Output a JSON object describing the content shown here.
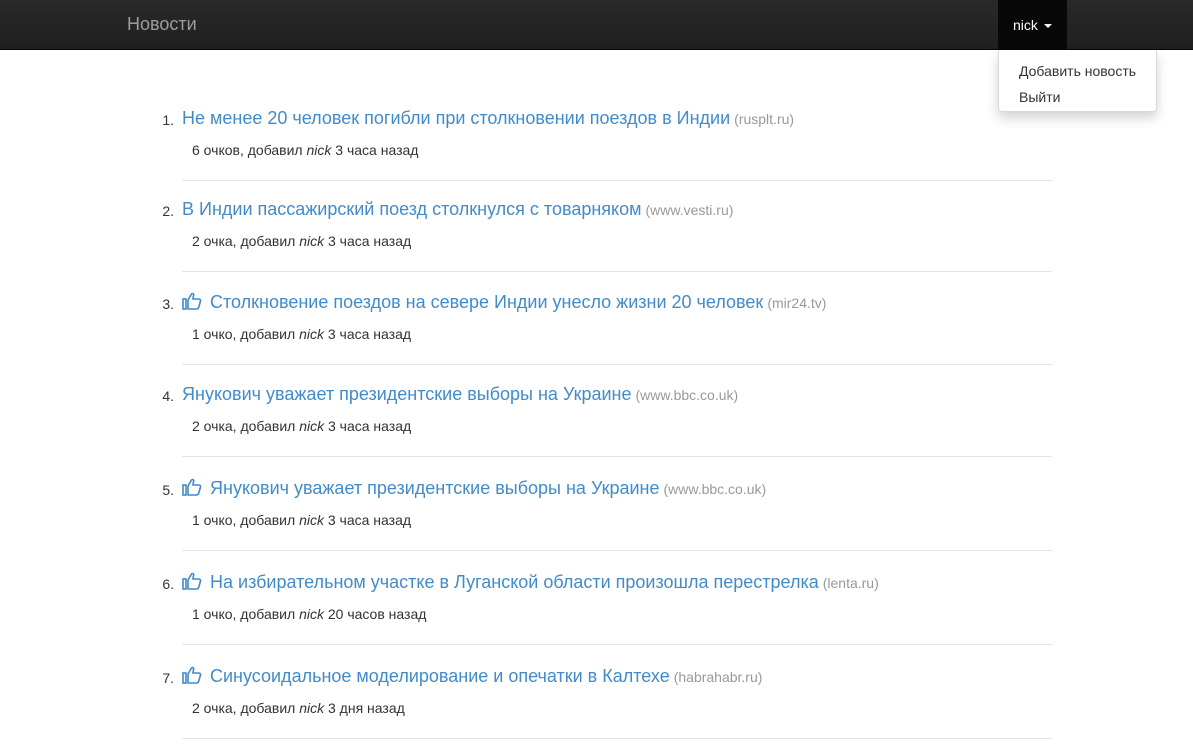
{
  "navbar": {
    "brand": "Новости",
    "user": "nick"
  },
  "dropdown": {
    "items": [
      "Добавить новость",
      "Выйти"
    ]
  },
  "news": [
    {
      "num": "1.",
      "liked": false,
      "title": "Не менее 20 человек погибли при столкновении поездов в Индии",
      "domain": "(rusplt.ru)",
      "points": "6 очков, добавил",
      "author": "nick",
      "time": "3 часа назад"
    },
    {
      "num": "2.",
      "liked": false,
      "title": "В Индии пассажирский поезд столкнулся с товарняком",
      "domain": "(www.vesti.ru)",
      "points": "2 очка, добавил",
      "author": "nick",
      "time": "3 часа назад"
    },
    {
      "num": "3.",
      "liked": true,
      "title": "Столкновение поездов на севере Индии унесло жизни 20 человек",
      "domain": "(mir24.tv)",
      "points": "1 очко, добавил",
      "author": "nick",
      "time": "3 часа назад"
    },
    {
      "num": "4.",
      "liked": false,
      "title": "Янукович уважает президентские выборы на Украине",
      "domain": "(www.bbc.co.uk)",
      "points": "2 очка, добавил",
      "author": "nick",
      "time": "3 часа назад"
    },
    {
      "num": "5.",
      "liked": true,
      "title": "Янукович уважает президентские выборы на Украине",
      "domain": "(www.bbc.co.uk)",
      "points": "1 очко, добавил",
      "author": "nick",
      "time": "3 часа назад"
    },
    {
      "num": "6.",
      "liked": true,
      "title": "На избирательном участке в Луганской области произошла перестрелка",
      "domain": "(lenta.ru)",
      "points": "1 очко, добавил",
      "author": "nick",
      "time": "20 часов назад"
    },
    {
      "num": "7.",
      "liked": true,
      "title": "Синусоидальное моделирование и опечатки в Калтехе",
      "domain": "(habrahabr.ru)",
      "points": "2 очка, добавил",
      "author": "nick",
      "time": "3 дня назад"
    }
  ]
}
